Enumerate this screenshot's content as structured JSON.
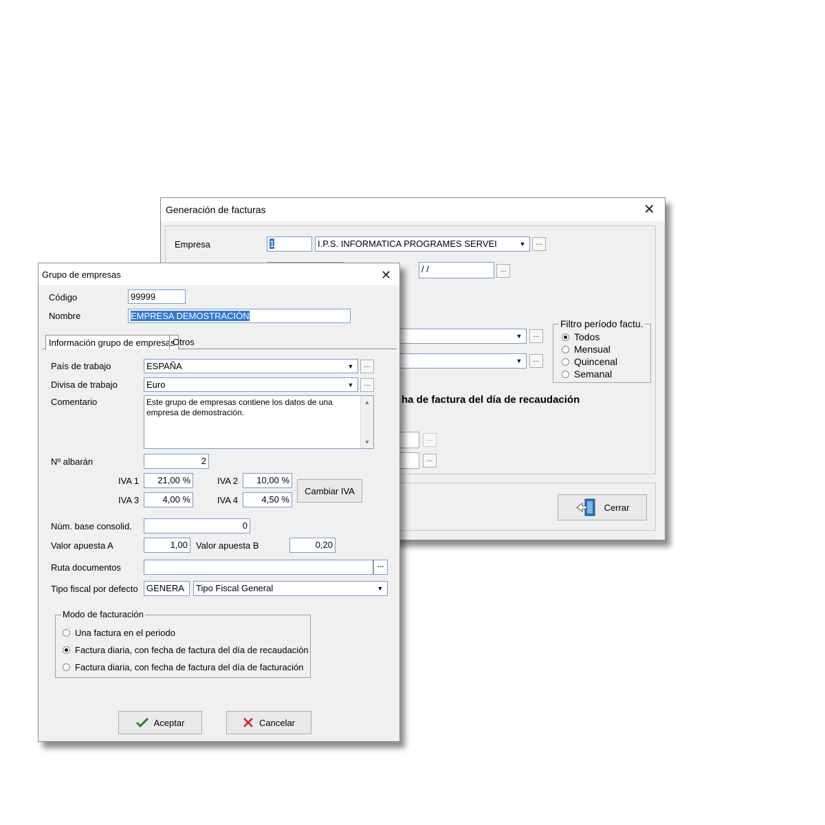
{
  "back_window": {
    "title": "Generación de facturas",
    "empresa_label": "Empresa",
    "empresa_code": "1",
    "empresa_name": "I.P.S. INFORMATICA PROGRAMES SERVEI",
    "date_value": "/ /",
    "bold_text": "ha de factura del día de recaudación",
    "filtro_group": {
      "caption": "Filtro período factu.",
      "options": [
        "Todos",
        "Mensual",
        "Quincenal",
        "Semanal"
      ],
      "selected": "Todos"
    },
    "cerrar_label": "Cerrar"
  },
  "front_window": {
    "title": "Grupo de empresas",
    "codigo_label": "Código",
    "codigo_value": "99999",
    "nombre_label": "Nombre",
    "nombre_value": "EMPRESA DEMOSTRACIÓN",
    "tabs": [
      "Información grupo de empresas",
      "Otros"
    ],
    "pais_label": "País de trabajo",
    "pais_value": "ESPAÑA",
    "divisa_label": "Divisa de trabajo",
    "divisa_value": "Euro",
    "comentario_label": "Comentario",
    "comentario_value": "Este grupo de empresas contiene los datos de una empresa de demostración.",
    "albaran_label": "Nº albarán",
    "albaran_value": "2",
    "iva1_label": "IVA 1",
    "iva1_value": "21,00 %",
    "iva2_label": "IVA 2",
    "iva2_value": "10,00 %",
    "iva3_label": "IVA 3",
    "iva3_value": "4,00 %",
    "iva4_label": "IVA 4",
    "iva4_value": "4,50 %",
    "cambiar_iva_label": "Cambiar IVA",
    "base_consolid_label": "Núm. base consolid.",
    "base_consolid_value": "0",
    "apuesta_a_label": "Valor apuesta A",
    "apuesta_a_value": "1,00",
    "apuesta_b_label": "Valor apuesta B",
    "apuesta_b_value": "0,20",
    "ruta_label": "Ruta documentos",
    "ruta_value": "",
    "ruta_button": "...",
    "tipo_fiscal_label": "Tipo fiscal por defecto",
    "tipo_fiscal_code": "GENERA",
    "tipo_fiscal_value": "Tipo Fiscal General",
    "modo_group": {
      "caption": "Modo de facturación",
      "options": [
        "Una factura en el periodo",
        "Factura diaria, con fecha de factura del día de recaudación",
        "Factura diaria, con fecha de factura del día de facturación"
      ],
      "selected_index": 1
    },
    "aceptar_label": "Aceptar",
    "cancelar_label": "Cancelar"
  },
  "ellipsis": "..."
}
